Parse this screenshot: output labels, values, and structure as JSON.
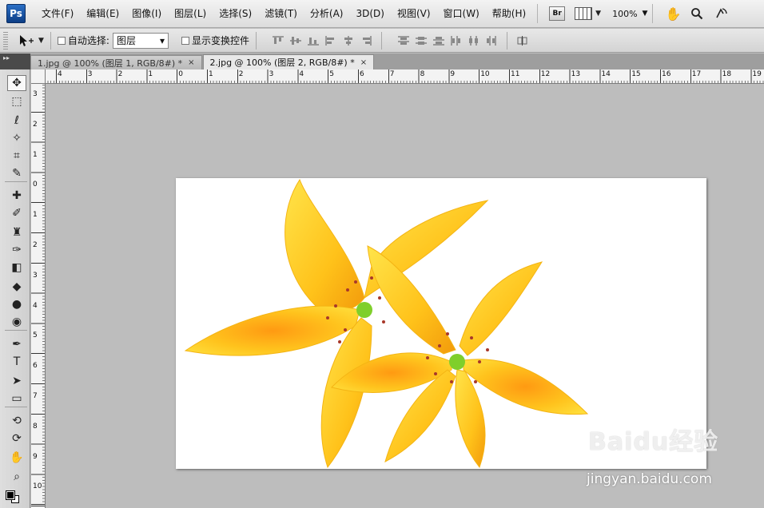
{
  "app": {
    "logo": "Ps"
  },
  "menu": {
    "items": [
      "文件(F)",
      "编辑(E)",
      "图像(I)",
      "图层(L)",
      "选择(S)",
      "滤镜(T)",
      "分析(A)",
      "3D(D)",
      "视图(V)",
      "窗口(W)",
      "帮助(H)"
    ],
    "bridge_label": "Br",
    "zoom": "100%",
    "caret": "▼"
  },
  "options": {
    "auto_select_label": "自动选择:",
    "auto_select_value": "图层",
    "show_transform_label": "显示变换控件",
    "select_caret": "▾"
  },
  "tabs": [
    {
      "label": "1.jpg @ 100% (图层 1, RGB/8#) *",
      "close": "×"
    },
    {
      "label": "2.jpg @ 100% (图层 2, RGB/8#) *",
      "close": "×"
    }
  ],
  "panel_collapse": "▸▸",
  "rulers": {
    "horizontal": [
      "4",
      "3",
      "2",
      "1",
      "0",
      "1",
      "2",
      "3",
      "4",
      "5",
      "6",
      "7",
      "8",
      "9",
      "10",
      "11",
      "12",
      "13",
      "14",
      "15",
      "16",
      "17",
      "18",
      "19"
    ],
    "vertical": [
      "3",
      "2",
      "1",
      "0",
      "1",
      "2",
      "3",
      "4",
      "5",
      "6",
      "7",
      "8",
      "9",
      "10"
    ]
  },
  "tools": [
    {
      "name": "move-tool",
      "glyph": "✥"
    },
    {
      "name": "marquee-tool",
      "glyph": "⬚"
    },
    {
      "name": "lasso-tool",
      "glyph": "ℓ"
    },
    {
      "name": "magic-wand-tool",
      "glyph": "✧"
    },
    {
      "name": "crop-tool",
      "glyph": "⌗"
    },
    {
      "name": "eyedropper-tool",
      "glyph": "✎"
    },
    {
      "name": "healing-brush-tool",
      "glyph": "✚"
    },
    {
      "name": "brush-tool",
      "glyph": "✐"
    },
    {
      "name": "clone-stamp-tool",
      "glyph": "♜"
    },
    {
      "name": "history-brush-tool",
      "glyph": "✑"
    },
    {
      "name": "eraser-tool",
      "glyph": "◧"
    },
    {
      "name": "paint-bucket-tool",
      "glyph": "◆"
    },
    {
      "name": "blur-tool",
      "glyph": "●"
    },
    {
      "name": "dodge-tool",
      "glyph": "◉"
    },
    {
      "name": "pen-tool",
      "glyph": "✒"
    },
    {
      "name": "type-tool",
      "glyph": "T"
    },
    {
      "name": "path-selection-tool",
      "glyph": "➤"
    },
    {
      "name": "rectangle-tool",
      "glyph": "▭"
    },
    {
      "name": "3d-rotate-tool",
      "glyph": "⟲"
    },
    {
      "name": "3d-orbit-tool",
      "glyph": "⟳"
    },
    {
      "name": "hand-tool",
      "glyph": "✋"
    },
    {
      "name": "zoom-tool",
      "glyph": "⌕"
    }
  ],
  "watermark": {
    "logo": "Baidu经验",
    "url": "jingyan.baidu.com"
  }
}
